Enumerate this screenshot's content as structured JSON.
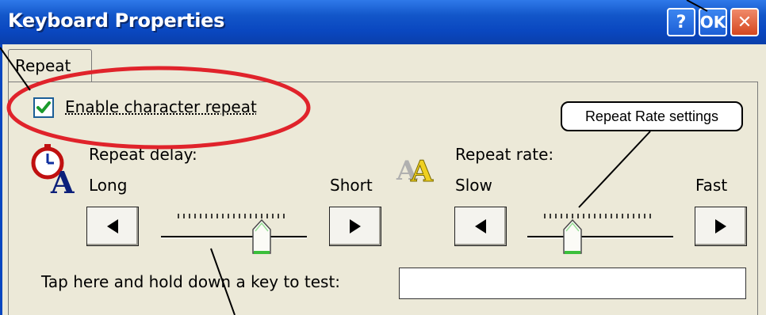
{
  "window": {
    "title": "Keyboard Properties"
  },
  "titlebar_buttons": {
    "help": "?",
    "ok": "OK",
    "close": "✕"
  },
  "tabs": [
    {
      "label": "Repeat"
    }
  ],
  "repeat": {
    "enable_label": "Enable character repeat",
    "enabled": true,
    "delay": {
      "label": "Repeat delay:",
      "min_label": "Long",
      "max_label": "Short",
      "value": 0.75
    },
    "rate": {
      "label": "Repeat rate:",
      "min_label": "Slow",
      "max_label": "Fast",
      "value": 0.25
    },
    "test_label": "Tap here and hold down a key to test:",
    "test_value": ""
  },
  "annotations": {
    "rate_callout": "Repeat Rate settings"
  },
  "colors": {
    "title_blue": "#0a47c0",
    "highlight_red": "#e0232b",
    "check_green": "#1a9a2c",
    "slider_thumb_green": "#3bbf3b"
  }
}
